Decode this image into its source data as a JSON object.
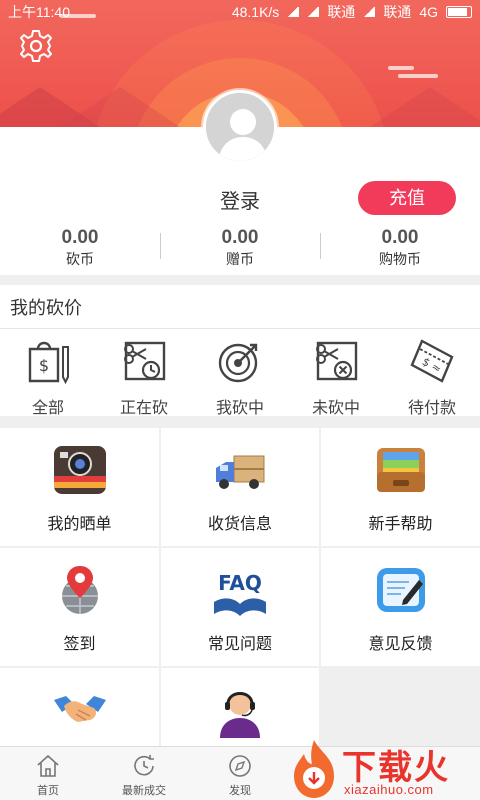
{
  "status": {
    "time": "上午11:40",
    "speed": "48.1K/s",
    "carrier1": "联通",
    "carrier2": "联通",
    "network": "4G"
  },
  "profile": {
    "login": "登录",
    "recharge": "充值"
  },
  "stats": [
    {
      "value": "0.00",
      "label": "砍币"
    },
    {
      "value": "0.00",
      "label": "赠币"
    },
    {
      "value": "0.00",
      "label": "购物币"
    }
  ],
  "bargain": {
    "title": "我的砍价",
    "items": [
      {
        "label": "全部",
        "icon": "shopping-bag-icon"
      },
      {
        "label": "正在砍",
        "icon": "coupon-clock-icon"
      },
      {
        "label": "我砍中",
        "icon": "target-icon"
      },
      {
        "label": "未砍中",
        "icon": "coupon-cross-icon"
      },
      {
        "label": "待付款",
        "icon": "ticket-icon"
      }
    ]
  },
  "grid": [
    {
      "label": "我的晒单",
      "icon": "camera-icon"
    },
    {
      "label": "收货信息",
      "icon": "delivery-truck-icon"
    },
    {
      "label": "新手帮助",
      "icon": "folder-icon"
    },
    {
      "label": "签到",
      "icon": "location-globe-icon"
    },
    {
      "label": "常见问题",
      "icon": "faq-book-icon"
    },
    {
      "label": "意见反馈",
      "icon": "note-edit-icon"
    },
    {
      "label": "",
      "icon": "handshake-icon"
    },
    {
      "label": "",
      "icon": "customer-service-icon"
    }
  ],
  "tabs": [
    {
      "label": "首页",
      "icon": "home-icon"
    },
    {
      "label": "最新成交",
      "icon": "clock-refresh-icon"
    },
    {
      "label": "发现",
      "icon": "compass-icon"
    }
  ],
  "watermark": {
    "text": "下载火",
    "url": "xiazaihuo.com"
  }
}
